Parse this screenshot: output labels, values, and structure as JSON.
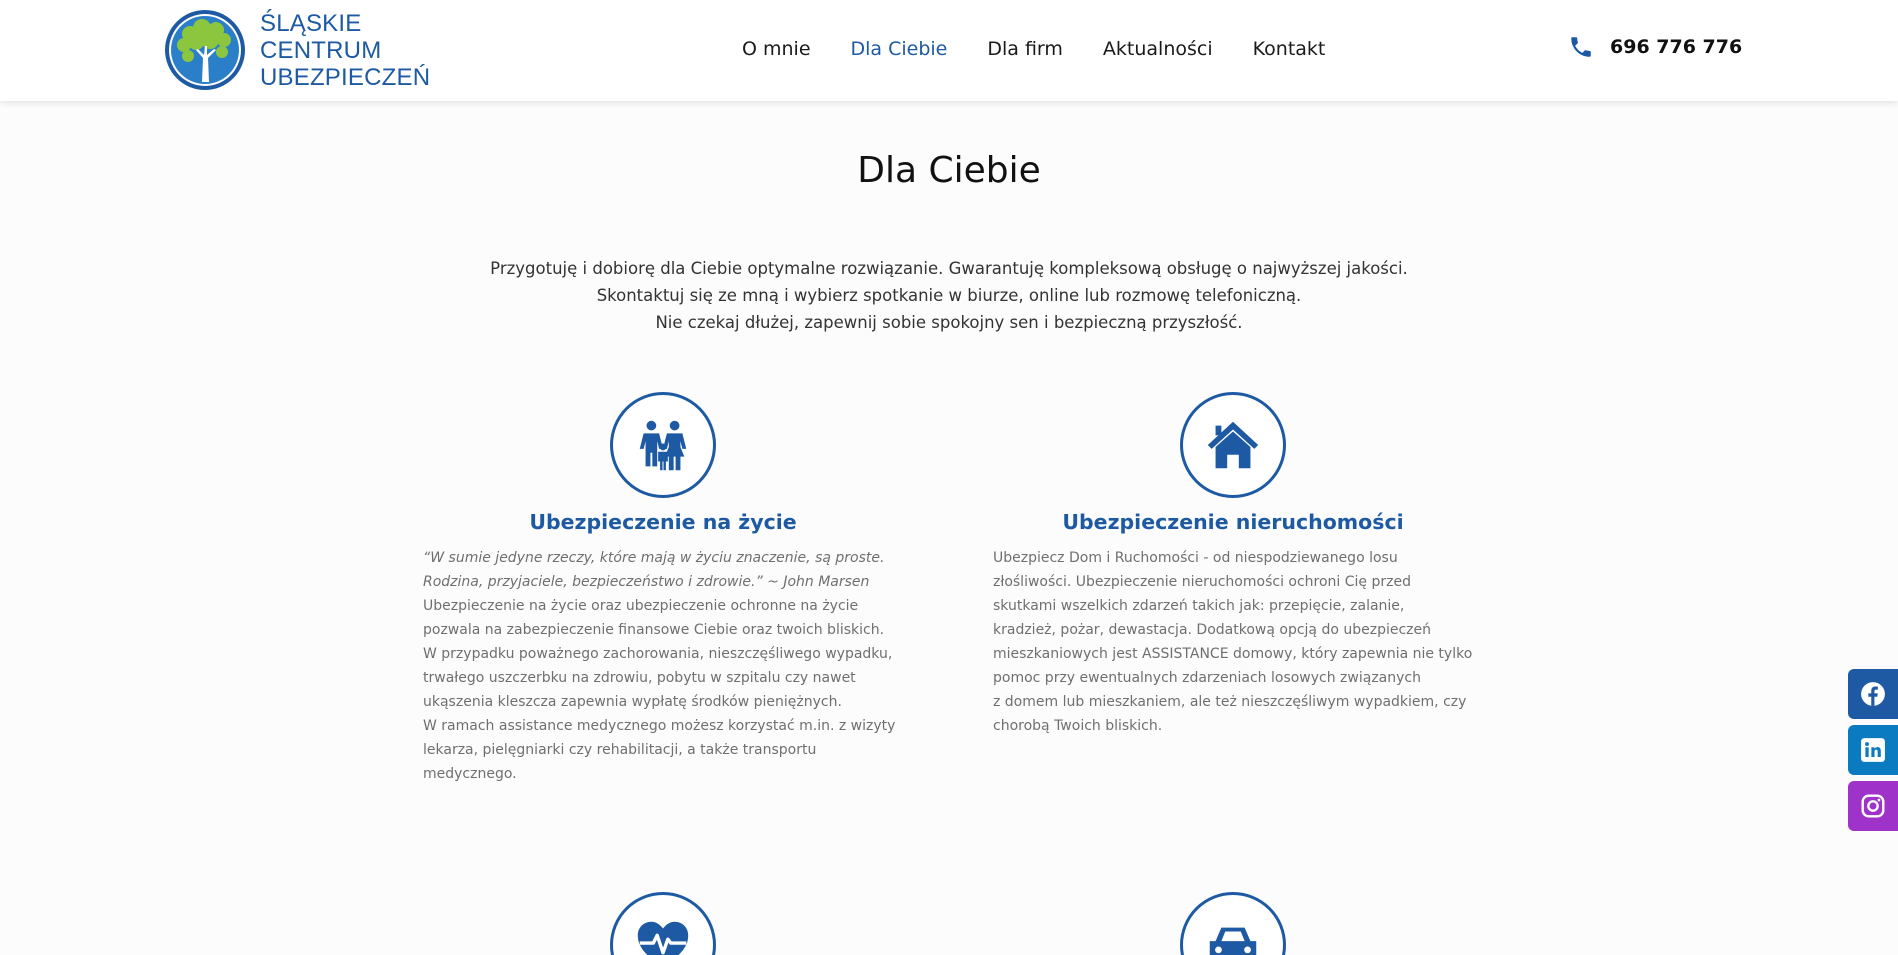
{
  "brand": {
    "line1": "ŚLĄSKIE",
    "line2": "CENTRUM",
    "line3": "UBEZPIECZEŃ",
    "color": "#1d5aa3",
    "leaf_color": "#8cc63f"
  },
  "nav": {
    "items": [
      {
        "label": "O mnie"
      },
      {
        "label": "Dla Ciebie"
      },
      {
        "label": "Dla firm"
      },
      {
        "label": "Aktualności"
      },
      {
        "label": "Kontakt"
      }
    ],
    "active_index": 1
  },
  "contact": {
    "phone": "696 776 776",
    "icon": "phone-icon"
  },
  "page": {
    "title": "Dla Ciebie",
    "intro": [
      "Przygotuję i dobiorę dla Ciebie optymalne rozwiązanie. Gwarantuję kompleksową obsługę o najwyższej jakości.",
      "Skontaktuj się ze mną i wybierz spotkanie w biurze, online lub rozmowę telefoniczną.",
      "Nie czekaj dłużej, zapewnij sobie spokojny sen i bezpieczną przyszłość."
    ]
  },
  "services": [
    {
      "icon": "family-icon",
      "title": "Ubezpieczenie na życie",
      "quote_lines": [
        "“W sumie jedyne rzeczy, które mają w życiu znaczenie, są proste.",
        "Rodzina, przyjaciele, bezpieczeństwo i zdrowie.” ~ John Marsen"
      ],
      "lines": [
        "Ubezpieczenie na życie oraz ubezpieczenie ochronne na życie",
        "pozwala na zabezpieczenie finansowe Ciebie oraz twoich bliskich.",
        "W przypadku poważnego zachorowania, nieszczęśliwego wypadku,",
        "trwałego uszczerbku na zdrowiu, pobytu w szpitalu czy nawet",
        "ukąszenia kleszcza zapewnia wypłatę środków pieniężnych.",
        "W ramach assistance medycznego możesz korzystać m.in. z wizyty",
        "lekarza, pielęgniarki czy rehabilitacji, a także transportu medycznego."
      ]
    },
    {
      "icon": "house-icon",
      "title": "Ubezpieczenie nieruchomości",
      "lines": [
        "Ubezpiecz Dom i Ruchomości - od niespodziewanego losu",
        "złośliwości. Ubezpieczenie nieruchomości ochroni Cię przed",
        "skutkami wszelkich zdarzeń takich jak: przepięcie, zalanie,",
        "kradzież, pożar, dewastacja. Dodatkową opcją do ubezpieczeń",
        "mieszkaniowych jest ASSISTANCE domowy, który zapewnia nie tylko",
        "pomoc przy ewentualnych zdarzeniach losowych związanych",
        "z domem lub mieszkaniem, ale też nieszczęśliwym wypadkiem, czy",
        "chorobą Twoich bliskich."
      ]
    },
    {
      "icon": "heart-pulse-icon"
    },
    {
      "icon": "car-icon"
    }
  ],
  "social": [
    {
      "icon": "facebook-icon",
      "color": "#1d5aa3"
    },
    {
      "icon": "linkedin-icon",
      "color": "#0a7bc0"
    },
    {
      "icon": "instagram-icon",
      "color": "#9f32c8"
    }
  ]
}
